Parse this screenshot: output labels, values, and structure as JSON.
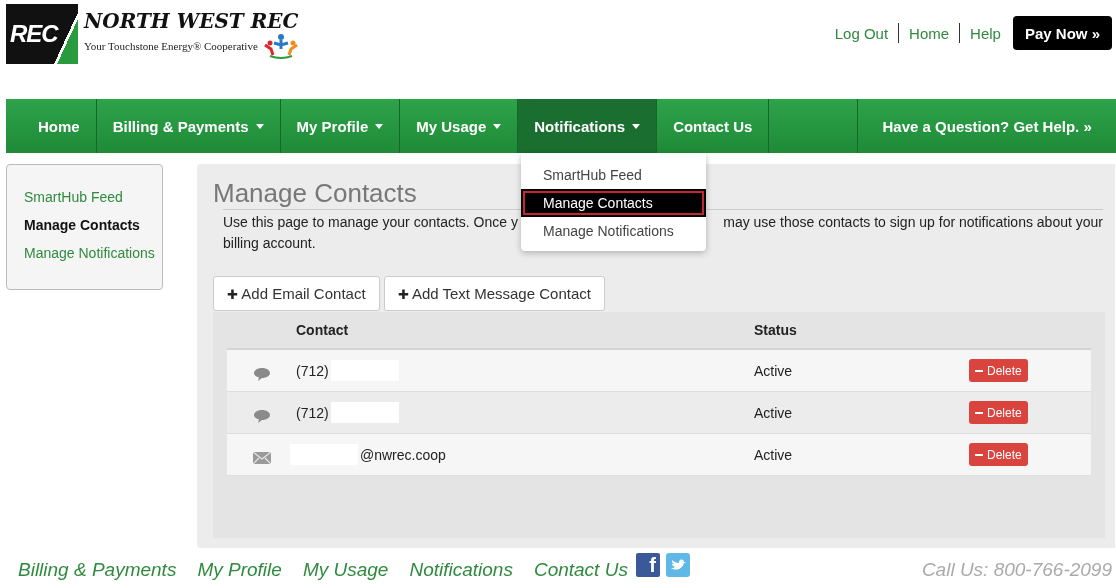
{
  "header": {
    "logo_mark": "REC",
    "logo_name": "NORTH WEST REC",
    "logo_tagline": "Your Touchstone Energy® Cooperative",
    "links": [
      "Log Out",
      "Home",
      "Help"
    ],
    "pay_button": "Pay Now »"
  },
  "nav": {
    "items": [
      {
        "label": "Home",
        "dropdown": false,
        "selected": false
      },
      {
        "label": "Billing & Payments",
        "dropdown": true,
        "selected": false
      },
      {
        "label": "My Profile",
        "dropdown": true,
        "selected": false
      },
      {
        "label": "My Usage",
        "dropdown": true,
        "selected": false
      },
      {
        "label": "Notifications",
        "dropdown": true,
        "selected": true
      },
      {
        "label": "Contact Us",
        "dropdown": false,
        "selected": false
      }
    ],
    "help": "Have a Question? Get Help. »"
  },
  "dropdown": {
    "items": [
      {
        "label": "SmartHub Feed",
        "selected": false
      },
      {
        "label": "Manage Contacts",
        "selected": true
      },
      {
        "label": "Manage Notifications",
        "selected": false
      }
    ]
  },
  "sidebar": {
    "items": [
      {
        "label": "SmartHub Feed",
        "selected": false
      },
      {
        "label": "Manage Contacts",
        "selected": true
      },
      {
        "label": "Manage Notifications",
        "selected": false
      }
    ]
  },
  "page": {
    "title": "Manage Contacts",
    "description": [
      "Use this page to manage your contacts. Once y",
      "may use those contacts to sign up for notifications about your",
      "billing account."
    ],
    "buttons": [
      "Add Email Contact",
      "Add Text Message Contact"
    ],
    "plus": "✚"
  },
  "table": {
    "columns": [
      "Contact",
      "Status"
    ],
    "rows": [
      {
        "kind": "text",
        "contact": "(712)",
        "status": "Active",
        "action": "Delete"
      },
      {
        "kind": "text",
        "contact": "(712)",
        "status": "Active",
        "action": "Delete"
      },
      {
        "kind": "email",
        "contact": "@nwrec.coop",
        "status": "Active",
        "action": "Delete"
      }
    ]
  },
  "footer": {
    "links": [
      "Billing & Payments",
      "My Profile",
      "My Usage",
      "Notifications",
      "Contact Us"
    ],
    "facebook": "f",
    "call": "Call Us: 800-766-2099"
  }
}
